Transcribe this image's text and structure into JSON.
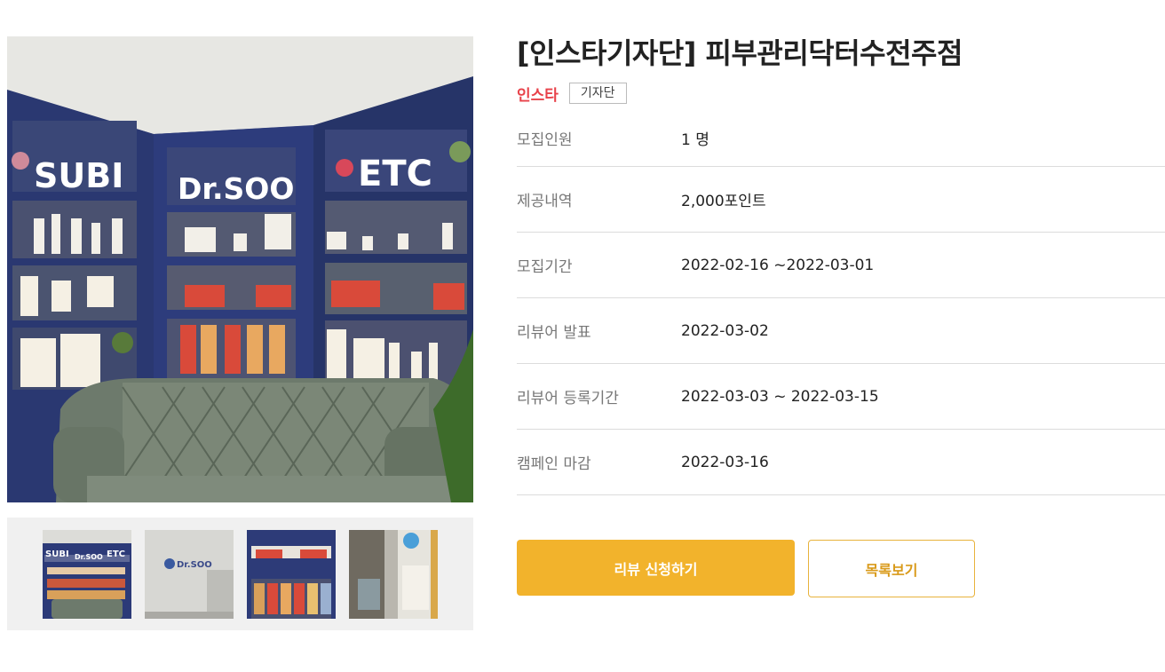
{
  "campaign": {
    "title": "[인스타기자단] 피부관리닥터수전주점",
    "sns_tag": "인스타",
    "type_badge": "기자단"
  },
  "details": [
    {
      "label": "모집인원",
      "value": "1 명"
    },
    {
      "label": "제공내역",
      "value": "2,000포인트"
    },
    {
      "label": "모집기간",
      "value": "2022-02-16 ~2022-03-01"
    },
    {
      "label": "리뷰어 발표",
      "value": "2022-03-02"
    },
    {
      "label": "리뷰어 등록기간",
      "value": "2022-03-03 ~ 2022-03-15"
    },
    {
      "label": "캠페인 마감",
      "value": "2022-03-16"
    }
  ],
  "photo": {
    "shelf_signs": [
      "SUBI",
      "Dr.SOO",
      "ETC"
    ],
    "thumb_sign": "Dr.SOO"
  },
  "buttons": {
    "apply_label": "리뷰 신청하기",
    "list_label": "목록보기"
  },
  "colors": {
    "sns_tag": "#e8424a",
    "apply_button": "#f2b32c",
    "list_border": "#e8b33c",
    "wall_blue": "#2b3a78"
  }
}
